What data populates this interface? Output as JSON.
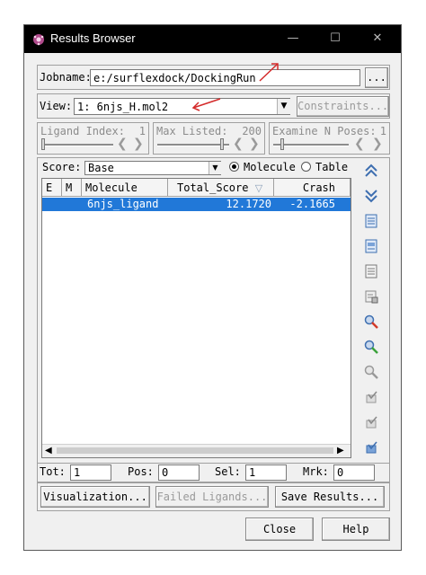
{
  "window": {
    "title": "Results Browser"
  },
  "jobname": {
    "label": "Jobname:",
    "value": "e:/surflexdock/DockingRun",
    "browse_label": "..."
  },
  "view": {
    "label": "View:",
    "value": "1: 6njs_H.mol2",
    "constraints_label": "Constraints..."
  },
  "sliders": [
    {
      "label": "Ligand Index:",
      "value": "1"
    },
    {
      "label": "Max Listed:",
      "value": "200"
    },
    {
      "label": "Examine N Poses:",
      "value": "1"
    }
  ],
  "score": {
    "label": "Score:",
    "value": "Base",
    "radio_molecule": "Molecule",
    "radio_table": "Table",
    "selected": "Molecule"
  },
  "table": {
    "columns": [
      "E",
      "M",
      "Molecule",
      "Total_Score",
      "Crash"
    ],
    "rows": [
      {
        "e": "",
        "m": "",
        "molecule": "6njs_ligand",
        "total_score": "12.1720",
        "crash": "-2.1665"
      }
    ]
  },
  "counts": {
    "tot_label": "Tot:",
    "tot": "1",
    "pos_label": "Pos:",
    "pos": "0",
    "sel_label": "Sel:",
    "sel": "1",
    "mrk_label": "Mrk:",
    "mrk": "0"
  },
  "actions": {
    "visualization": "Visualization...",
    "failed_ligands": "Failed Ligands...",
    "save_results": "Save Results..."
  },
  "footer": {
    "close": "Close",
    "help": "Help"
  },
  "colors": {
    "selection": "#2178d8",
    "annotation_arrow": "#d42a2a",
    "toolbar_icon": "#3e6fb0"
  },
  "side_toolbar_icons": [
    "move-top-icon",
    "move-bottom-icon",
    "list-icon",
    "list-view-icon",
    "list-plain-icon",
    "edit-icon",
    "search-red-icon",
    "search-green-icon",
    "search-gray-icon",
    "check-gray-icon",
    "check-gray-icon",
    "check-blue-icon"
  ]
}
